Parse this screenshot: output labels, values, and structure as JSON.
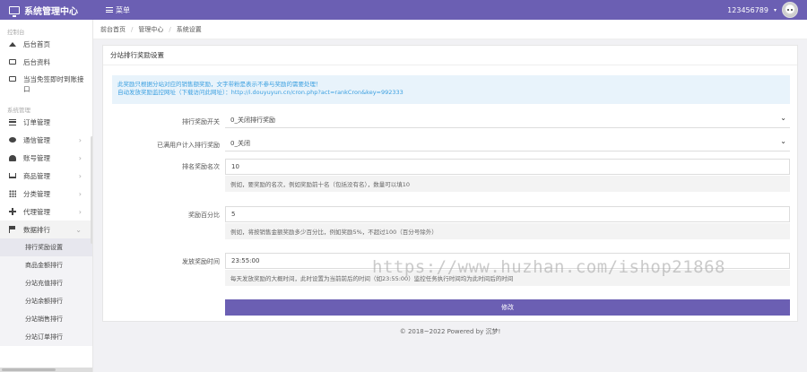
{
  "header": {
    "title": "系统管理中心",
    "menu_label": "菜单",
    "username": "123456789",
    "caret": "▾"
  },
  "sidebar": {
    "section1": "控制台",
    "top_items": [
      {
        "label": "后台首页",
        "icon": "home-icon"
      },
      {
        "label": "后台资料",
        "icon": "id-card-icon"
      },
      {
        "label": "当当免签即时到账接口",
        "icon": "id-card-icon"
      }
    ],
    "section2": "系统管理",
    "items": [
      {
        "label": "订单管理",
        "icon": "list-icon",
        "arrow": ""
      },
      {
        "label": "通信管理",
        "icon": "chat-icon",
        "arrow": "›"
      },
      {
        "label": "账号管理",
        "icon": "user-icon",
        "arrow": "›"
      },
      {
        "label": "商品管理",
        "icon": "cart-icon",
        "arrow": "›"
      },
      {
        "label": "分类管理",
        "icon": "grid-icon",
        "arrow": "›"
      },
      {
        "label": "代理管理",
        "icon": "plus-icon",
        "arrow": "›"
      },
      {
        "label": "数据排行",
        "icon": "flag-icon",
        "arrow": "⌄"
      }
    ],
    "sub_items": [
      "排行奖励设置",
      "商品金额排行",
      "分站充值排行",
      "分站余额排行",
      "分站销售排行",
      "分站订单排行"
    ]
  },
  "breadcrumb": {
    "home": "前台首页",
    "mid": "管理中心",
    "current": "系统设置",
    "sep": "/"
  },
  "card": {
    "title": "分站排行奖励设置",
    "notice_line1": "此奖励只根据分站对应的销售额奖励，文字带粉是表示不参与奖励的需要处理！",
    "notice_line2": "自动发放奖励监控网址（下载访问此网址）：http://i.douyuyun.cn/cron.php?act=rankCron&key=992333"
  },
  "form": {
    "reward_days": {
      "label": "排行奖励开关",
      "value": "0_关闭排行奖励"
    },
    "top10": {
      "label": "已满用户计入排行奖励",
      "value": "0_关闭"
    },
    "count": {
      "label": "排名奖励名次",
      "value": "10",
      "help": "例如，要奖励的名次，例如奖励前十名（包括没有名），数量可以填10"
    },
    "percent": {
      "label": "奖励百分比",
      "value": "5",
      "help": "例如，将按销售金额奖励多少百分比，例如奖励5%，不超过100（百分号除外）"
    },
    "time": {
      "label": "发放奖励时间",
      "value": "23:55:00",
      "help": "每天发放奖励的大概时间，此时设置为当前前后的时间（如23:55:00）监控任务执行时间均为此时间后的时间"
    },
    "submit_label": "修改"
  },
  "footer": {
    "text": "© 2018~2022 Powered by 沉梦!"
  },
  "watermark": {
    "text": "https://www.huzhan.com/ishop21868"
  }
}
